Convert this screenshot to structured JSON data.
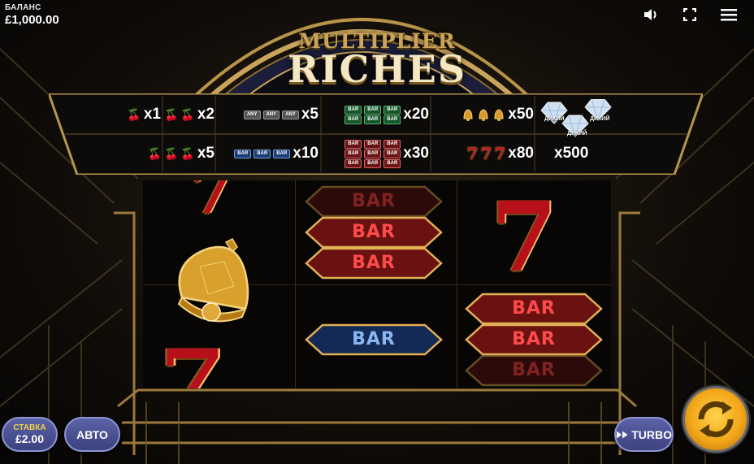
{
  "balance": {
    "label": "БАЛАНС",
    "value": "£1,000.00"
  },
  "top_icons": [
    "speaker-icon",
    "fullscreen-icon",
    "menu-icon"
  ],
  "logo": {
    "top": "MULTIPLIER",
    "main": "RICHES"
  },
  "paytable": {
    "row1": [
      {
        "symbol": "cherry",
        "count": 1,
        "mult": "x1"
      },
      {
        "symbol": "cherry",
        "count": 2,
        "mult": "x2"
      },
      {
        "symbol": "any-bar",
        "count": 3,
        "label": "ANY",
        "mult": "x5"
      },
      {
        "symbol": "green-bar",
        "count": 3,
        "label": "BAR",
        "mult": "x20"
      },
      {
        "symbol": "bell",
        "count": 3,
        "mult": "x50"
      }
    ],
    "row2": [
      {
        "symbol": "cherry",
        "count": 3,
        "mult": "x5"
      },
      {
        "symbol": "blue-bar",
        "count": 3,
        "label": "BAR",
        "mult": "x10"
      },
      {
        "symbol": "red-bar",
        "count": 3,
        "label": "BAR",
        "mult": "x30"
      },
      {
        "symbol": "seven",
        "count": 3,
        "label": "7",
        "mult": "x80"
      }
    ],
    "wild": {
      "label": "ДИКИЙ",
      "mult": "x500"
    }
  },
  "reels": {
    "bar_label": "BAR",
    "seven_label": "7",
    "reel1": [
      "seven-partial",
      "bell",
      "seven-partial"
    ],
    "reel2": [
      "red-triple-bar",
      "blue-bar"
    ],
    "reel3": [
      "seven",
      "red-triple-bar"
    ]
  },
  "controls": {
    "stake_label": "СТАВКА",
    "stake_value": "£2.00",
    "auto_label": "АВТО",
    "turbo_label": "TURBO"
  },
  "colors": {
    "gold": "#caa45a",
    "button_blue": "#4a5196",
    "spin_gold": "#f3a71a",
    "stake_label": "#f0d44a"
  }
}
